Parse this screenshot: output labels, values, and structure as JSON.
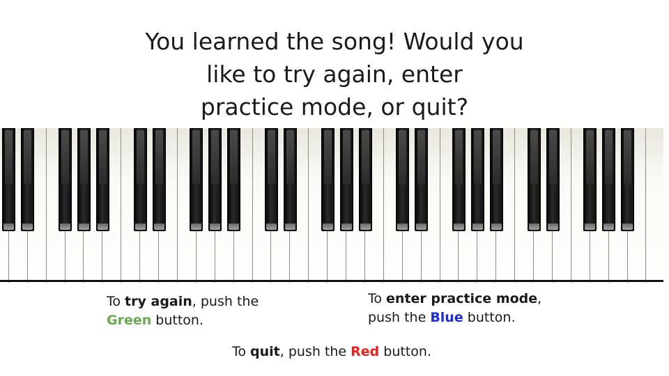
{
  "headline": {
    "line1": "You learned the song! Would you",
    "line2": "like to try again, enter",
    "line3": "practice mode, or quit?"
  },
  "keyboard": {
    "white_key_count": 36,
    "black_key_pattern": [
      1,
      1,
      0,
      1,
      1,
      1,
      0
    ]
  },
  "instructions": {
    "retry": {
      "prefix": "To ",
      "action": "try again",
      "middle": ", push the",
      "color_word": "Green",
      "suffix": " button."
    },
    "practice": {
      "prefix": "To ",
      "action": "enter practice mode",
      "middle": ",",
      "line2_prefix": "push the ",
      "color_word": "Blue",
      "suffix": " button."
    },
    "quit": {
      "prefix": "To ",
      "action": "quit",
      "middle": ", push the ",
      "color_word": "Red",
      "suffix": " button."
    }
  },
  "colors": {
    "green": "#6aa84f",
    "blue": "#1d2bd6",
    "red": "#e8221b"
  }
}
